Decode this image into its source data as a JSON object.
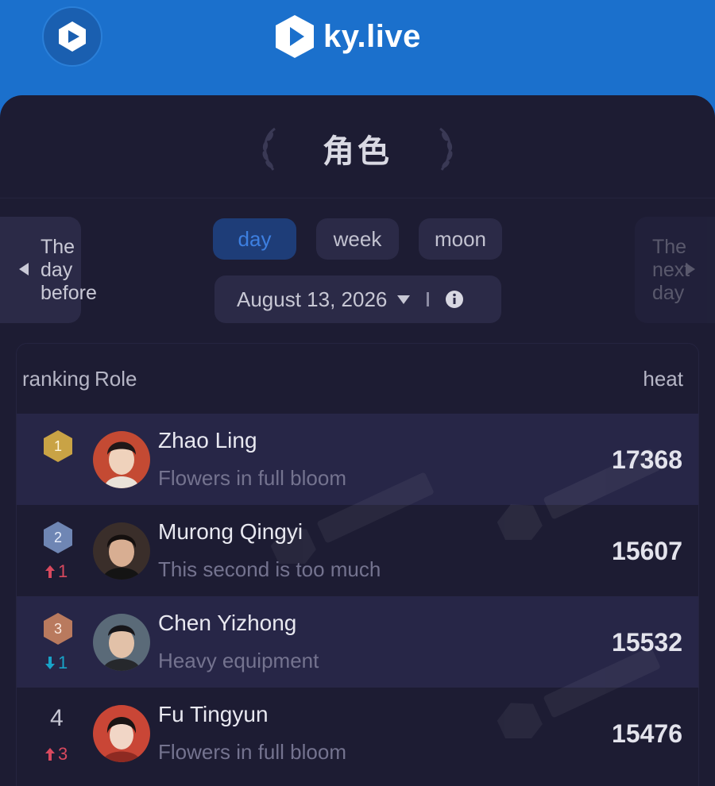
{
  "header": {
    "brand": "ky.live",
    "accent": "#1b70cc"
  },
  "page": {
    "title": "角色"
  },
  "nav": {
    "prev_label": "The day before",
    "next_label": "The next day"
  },
  "tabs": [
    {
      "label": "day",
      "active": true
    },
    {
      "label": "week",
      "active": false
    },
    {
      "label": "moon",
      "active": false
    }
  ],
  "date_picker": {
    "value": "August 13, 2026"
  },
  "table": {
    "headers": {
      "ranking": "ranking",
      "role": "Role",
      "heat": "heat"
    },
    "rows": [
      {
        "rank": "1",
        "name": "Zhao Ling",
        "sub": "Flowers in full bloom",
        "heat": "17368",
        "trend": "",
        "trend_dir": "none",
        "badge": "gold"
      },
      {
        "rank": "2",
        "name": "Murong Qingyi",
        "sub": "This second is too much",
        "heat": "15607",
        "trend": "1",
        "trend_dir": "up",
        "badge": "silver"
      },
      {
        "rank": "3",
        "name": "Chen Yizhong",
        "sub": "Heavy equipment",
        "heat": "15532",
        "trend": "1",
        "trend_dir": "down",
        "badge": "bronze"
      },
      {
        "rank": "4",
        "name": "Fu Tingyun",
        "sub": "Flowers in full bloom",
        "heat": "15476",
        "trend": "3",
        "trend_dir": "up",
        "badge": "none"
      }
    ]
  },
  "colors": {
    "gold": "#c9a345",
    "silver": "#6f86b4",
    "bronze": "#b97a5e",
    "up": "#d8495e",
    "down": "#18a3c8"
  }
}
